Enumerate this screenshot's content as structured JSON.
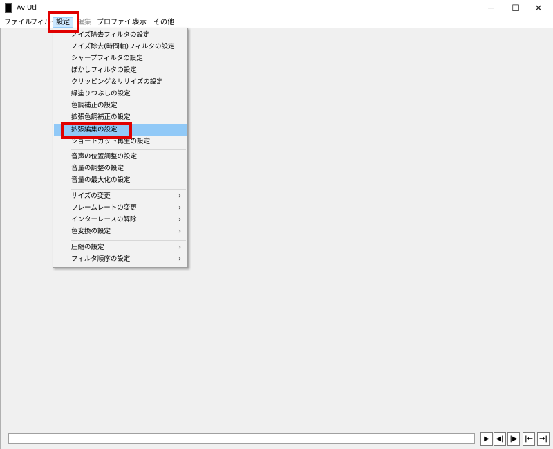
{
  "window": {
    "title": "AviUtl",
    "minimize_glyph": "─",
    "maximize_glyph": "☐",
    "close_glyph": "✕"
  },
  "menubar": {
    "items": [
      {
        "label": "ファイル"
      },
      {
        "label": "フィルタ"
      },
      {
        "label": "設定"
      },
      {
        "label": "編集"
      },
      {
        "label": "プロファイル"
      },
      {
        "label": "表示"
      },
      {
        "label": "その他"
      }
    ]
  },
  "settings_menu": {
    "items": [
      {
        "label": "ノイズ除去フィルタの設定"
      },
      {
        "label": "ノイズ除去(時間軸)フィルタの設定"
      },
      {
        "label": "シャープフィルタの設定"
      },
      {
        "label": "ぼかしフィルタの設定"
      },
      {
        "label": "クリッピング＆リサイズの設定"
      },
      {
        "label": "縁塗りつぶしの設定"
      },
      {
        "label": "色調補正の設定"
      },
      {
        "label": "拡張色調補正の設定"
      },
      {
        "label": "拡張編集の設定"
      },
      {
        "label": "ショートカット再生の設定"
      },
      {
        "label": "音声の位置調整の設定"
      },
      {
        "label": "音量の調整の設定"
      },
      {
        "label": "音量の最大化の設定"
      },
      {
        "label": "サイズの変更",
        "arrow": "›"
      },
      {
        "label": "フレームレートの変更",
        "arrow": "›"
      },
      {
        "label": "インターレースの解除",
        "arrow": "›"
      },
      {
        "label": "色変換の設定",
        "arrow": "›"
      },
      {
        "label": "圧縮の設定",
        "arrow": "›"
      },
      {
        "label": "フィルタ順序の設定",
        "arrow": "›"
      }
    ],
    "highlighted_item": "拡張編集の設定"
  },
  "playback_controls": {
    "play": "▶",
    "prev_frame": "◀|",
    "next_frame": "|▶",
    "to_start": "|←",
    "to_end": "→|"
  },
  "colors": {
    "highlight": "#91c9f7",
    "annotation_red": "#e00000",
    "menu_active": "#cce8ff"
  }
}
